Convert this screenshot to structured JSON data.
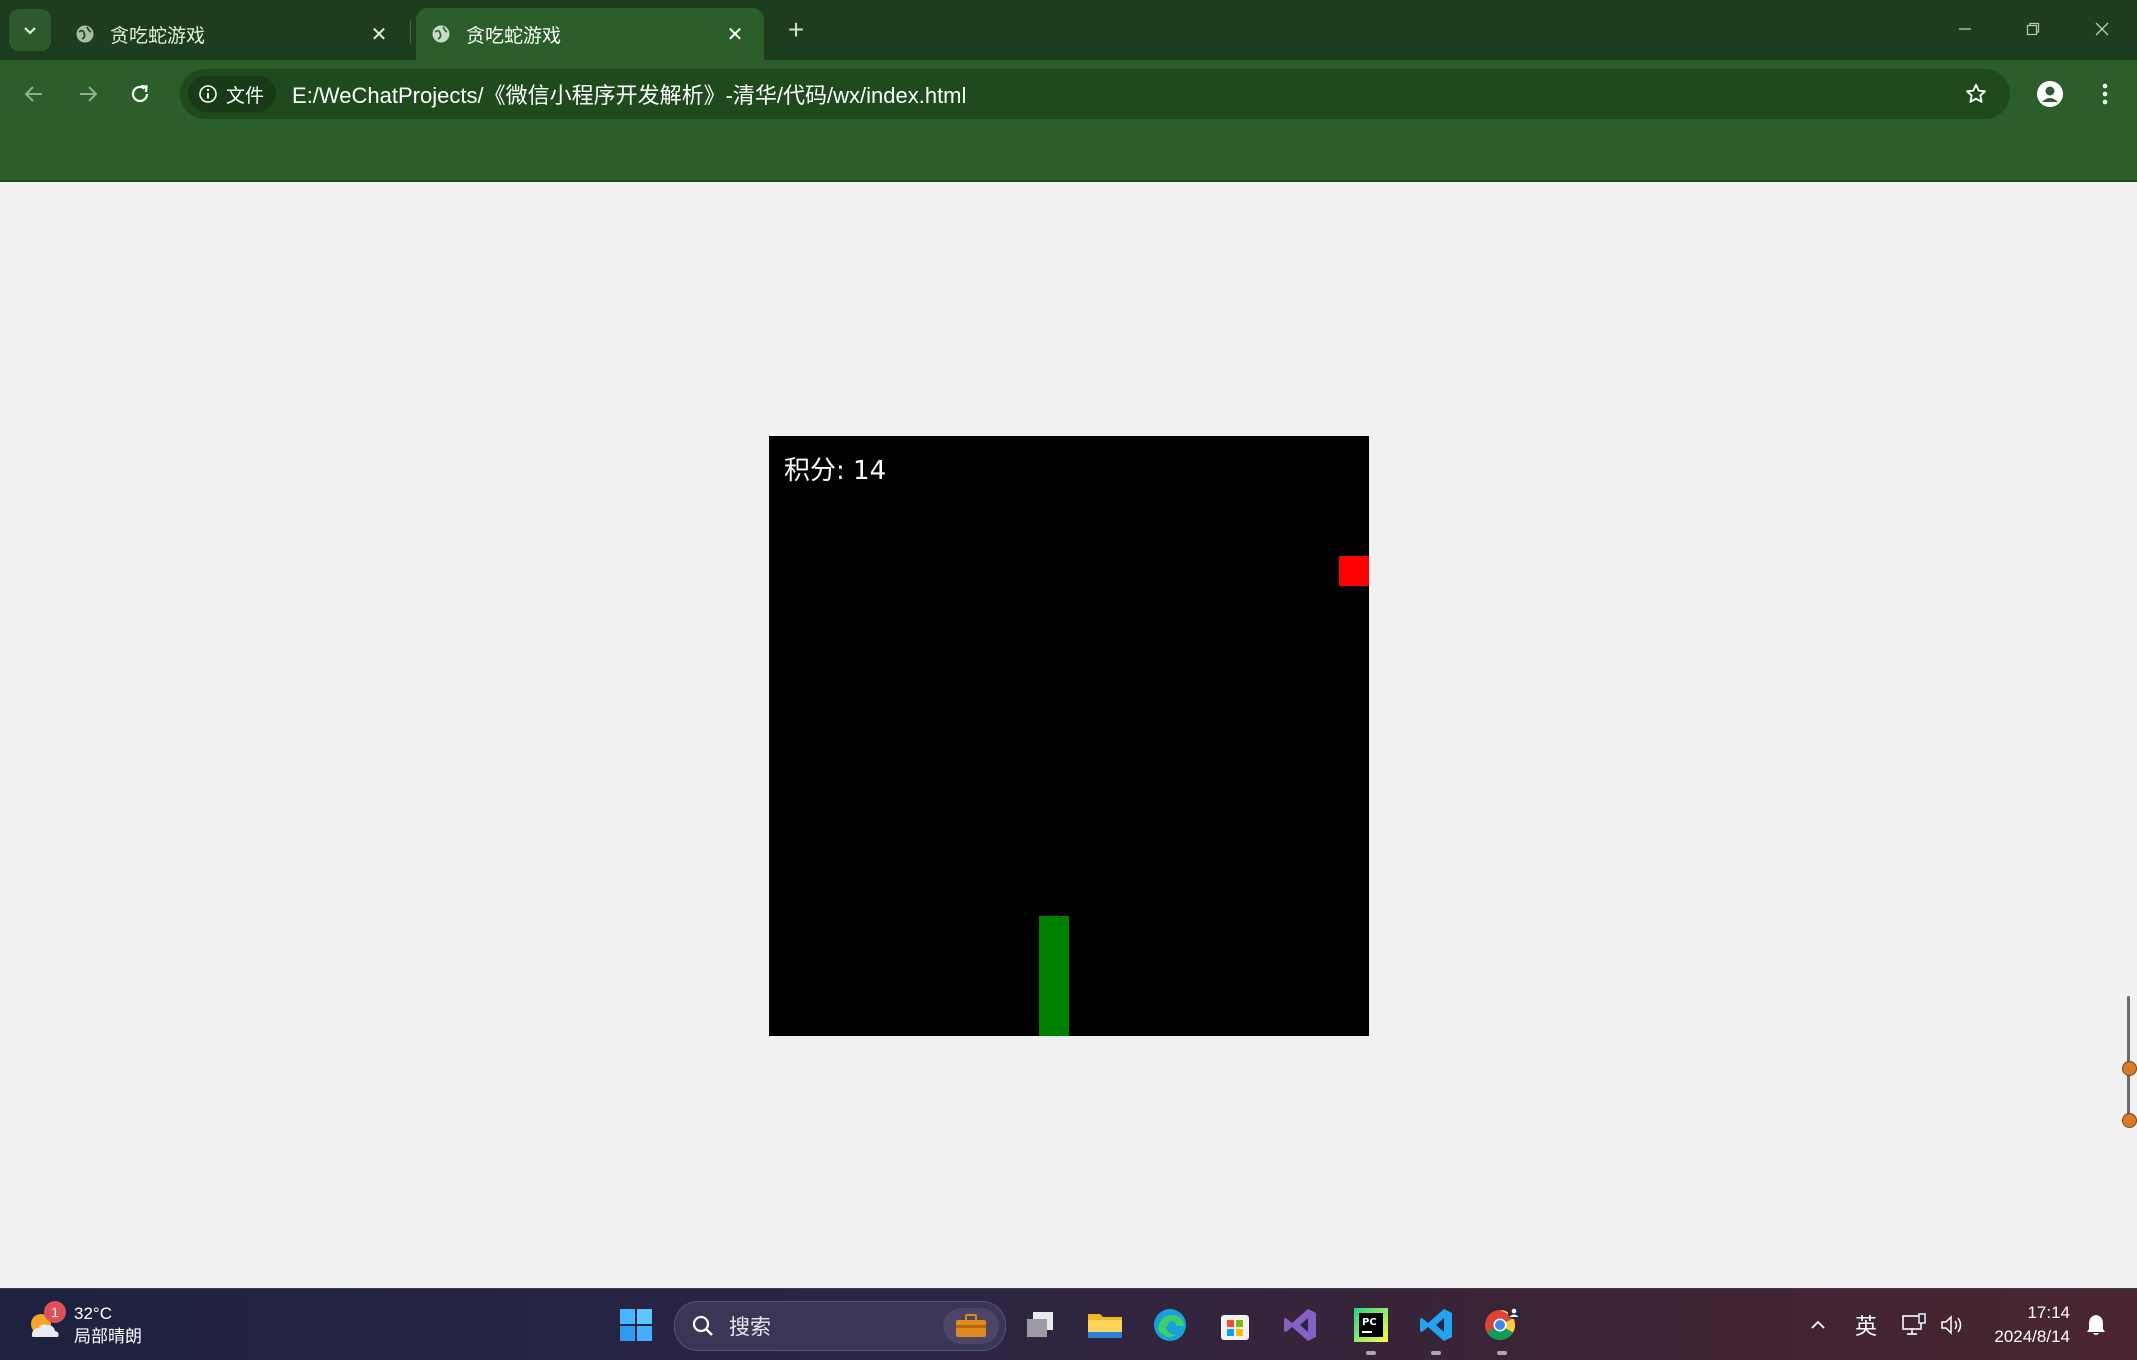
{
  "browser": {
    "tabs": [
      {
        "title": "贪吃蛇游戏",
        "active": false
      },
      {
        "title": "贪吃蛇游戏",
        "active": true
      }
    ],
    "site_info_label": "文件",
    "url": "E:/WeChatProjects/《微信小程序开发解析》-清华/代码/wx/index.html",
    "accent_color": "#2b5e2b"
  },
  "game": {
    "score_label": "积分: 14",
    "canvas_color": "#000000",
    "food_color": "#ff0000",
    "snake_color": "#008000"
  },
  "taskbar": {
    "weather": {
      "temperature": "32°C",
      "condition": "局部晴朗",
      "badge": "1"
    },
    "search_label": "搜索",
    "ime": "英",
    "time": "17:14",
    "date": "2024/8/14",
    "pinned_apps": [
      "task-view",
      "file-explorer",
      "edge",
      "microsoft-store",
      "visual-studio",
      "pycharm",
      "vscode",
      "chrome"
    ]
  }
}
